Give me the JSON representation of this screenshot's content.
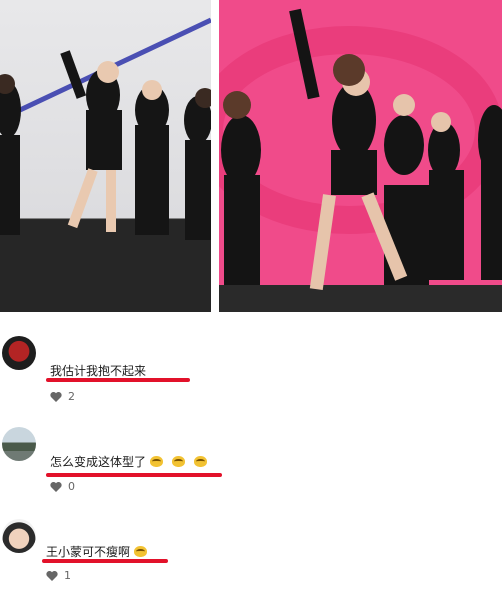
{
  "comments": [
    {
      "text": "我估计我抱不起来",
      "likes": "2",
      "emoji_count": 0
    },
    {
      "text": "怎么变成这体型了",
      "likes": "0",
      "emoji_count": 3
    },
    {
      "text": "王小蒙可不瘦啊",
      "likes": "1",
      "emoji_count": 1
    }
  ],
  "colors": {
    "underline": "#e2112a",
    "stage_pink": "#f04b8a",
    "heart": "#666666"
  },
  "icons": [
    "heart-icon",
    "emoji-icon"
  ]
}
